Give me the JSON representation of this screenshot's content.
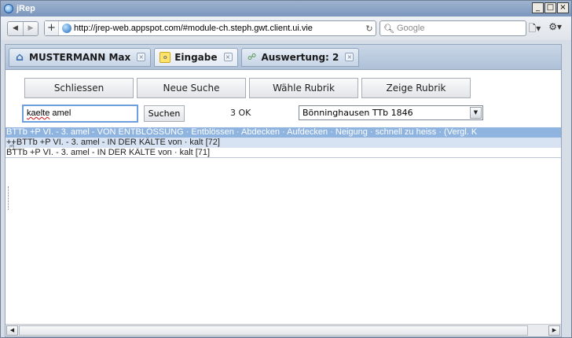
{
  "window": {
    "title": "jRep",
    "controls": [
      "_",
      "□",
      "×"
    ]
  },
  "browser": {
    "back_icon": "back-arrow-icon",
    "forward_icon": "forward-arrow-icon",
    "url": "http://jrep-web.appspot.com/#module-ch.steph.gwt.client.ui.vie",
    "search_placeholder": "Google"
  },
  "tabs": [
    {
      "label": "MUSTERMANN Max",
      "icon": "home-icon"
    },
    {
      "label": "Eingabe",
      "icon": "document-icon"
    },
    {
      "label": "Auswertung: 2",
      "icon": "graph-icon"
    }
  ],
  "buttons": {
    "schliessen": "Schliessen",
    "neue_suche": "Neue Suche",
    "waehle_rubrik": "Wähle Rubrik",
    "zeige_rubrik": "Zeige Rubrik"
  },
  "search": {
    "query_misspelled": "kaelte",
    "query_rest": " amel",
    "button": "Suchen",
    "result_count": "3 OK",
    "repertory": "Bönninghausen TTb 1846"
  },
  "results": [
    "BTTb +P    VI. - 3. amel - VON ENTBLÖSSUNG · Entblössen · Abdecken · Aufdecken · Neigung · schnell zu heiss · (Vergl. K",
    "++BTTb +P  VI. - 3. amel - IN DER KÄLTE von · kalt [72]",
    "BTTb +P    VI. - 3. amel - IN DER KÄLTE von · kalt  [71]"
  ]
}
